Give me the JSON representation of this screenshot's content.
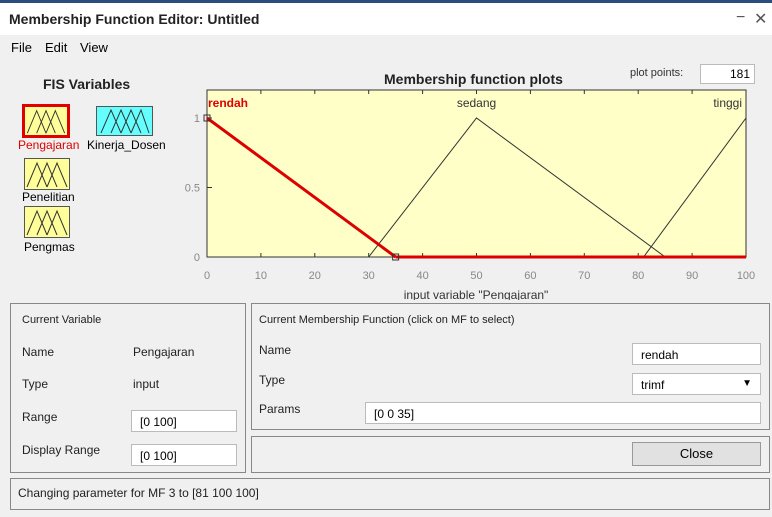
{
  "window": {
    "title": "Membership Function Editor: Untitled",
    "minimize": "−",
    "close": "✕"
  },
  "menu": {
    "file": "File",
    "edit": "Edit",
    "view": "View"
  },
  "fis": {
    "heading": "FIS Variables",
    "variables": [
      {
        "name": "Pengajaran",
        "selected": true
      },
      {
        "name": "Kinerja_Dosen",
        "selected": false
      },
      {
        "name": "Penelitian",
        "selected": false
      },
      {
        "name": "Pengmas",
        "selected": false
      }
    ]
  },
  "plot": {
    "title": "Membership function plots",
    "plot_points_label": "plot points:",
    "plot_points": "181",
    "xlabel": "input variable \"Pengajaran\""
  },
  "chart_data": {
    "type": "line",
    "xlim": [
      0,
      100
    ],
    "ylim": [
      0,
      1
    ],
    "xticks": [
      "0",
      "10",
      "20",
      "30",
      "40",
      "50",
      "60",
      "70",
      "80",
      "90",
      "100"
    ],
    "yticks": [
      "0",
      "0.5",
      "1"
    ],
    "background": "#ffffc8",
    "series": [
      {
        "name": "rendah",
        "points": [
          [
            0,
            1
          ],
          [
            35,
            0
          ]
        ],
        "color": "#dd0000",
        "selected": true
      },
      {
        "name": "sedang",
        "points": [
          [
            30,
            0
          ],
          [
            50,
            1
          ],
          [
            85,
            0
          ]
        ],
        "color": "#333333",
        "selected": false
      },
      {
        "name": "tinggi",
        "points": [
          [
            81,
            0
          ],
          [
            100,
            1
          ],
          [
            100,
            1
          ]
        ],
        "color": "#333333",
        "selected": false
      }
    ]
  },
  "current_variable": {
    "heading": "Current Variable",
    "name_label": "Name",
    "name_value": "Pengajaran",
    "type_label": "Type",
    "type_value": "input",
    "range_label": "Range",
    "range_value": "[0 100]",
    "display_range_label": "Display Range",
    "display_range_value": "[0 100]"
  },
  "current_mf": {
    "heading": "Current Membership Function (click on MF to select)",
    "name_label": "Name",
    "name_value": "rendah",
    "type_label": "Type",
    "type_value": "trimf",
    "params_label": "Params",
    "params_value": "[0 0 35]"
  },
  "close_button": "Close",
  "status": "Changing parameter for MF 3 to  [81 100 100]",
  "colors": {
    "selected_border": "#e00000",
    "input_fill": "#ffff99",
    "output_fill": "#66ffff"
  }
}
